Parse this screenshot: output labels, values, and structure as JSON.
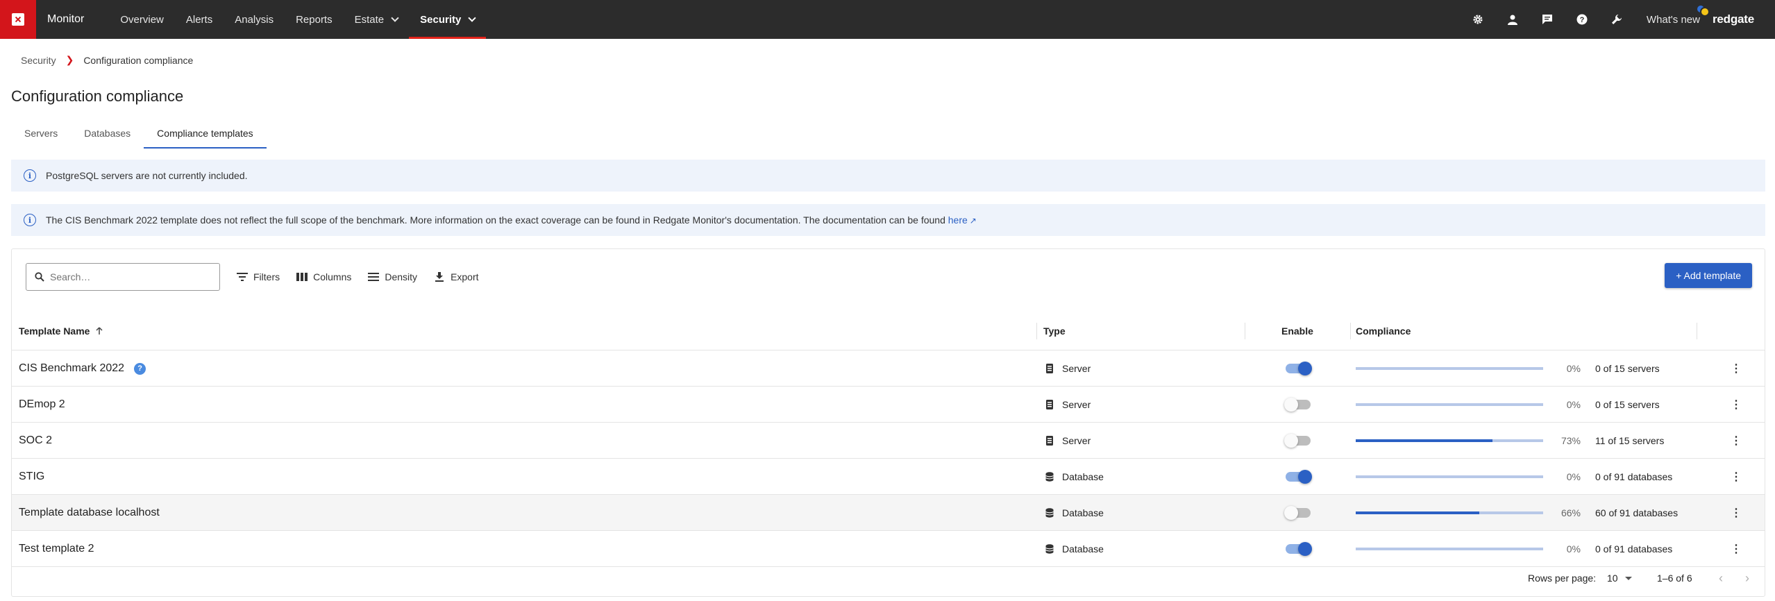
{
  "app": {
    "name": "Monitor",
    "brand": "redgate"
  },
  "nav": {
    "items": [
      {
        "label": "Overview"
      },
      {
        "label": "Alerts"
      },
      {
        "label": "Analysis"
      },
      {
        "label": "Reports"
      },
      {
        "label": "Estate"
      },
      {
        "label": "Security"
      }
    ],
    "active": "Security",
    "whats_new": "What's new",
    "icons": [
      "gear-icon",
      "user-icon",
      "chat-icon",
      "help-icon",
      "wrench-icon"
    ]
  },
  "breadcrumb": {
    "parent": "Security",
    "current": "Configuration compliance"
  },
  "page": {
    "title": "Configuration compliance"
  },
  "tabs": [
    {
      "label": "Servers"
    },
    {
      "label": "Databases"
    },
    {
      "label": "Compliance templates"
    }
  ],
  "alerts": {
    "postgres": "PostgreSQL servers are not currently included.",
    "cis_text": "The CIS Benchmark 2022 template does not reflect the full scope of the benchmark. More information on the exact coverage can be found in Redgate Monitor's documentation. The documentation can be found ",
    "cis_link": "here"
  },
  "toolbar": {
    "search_placeholder": "Search…",
    "filters": "Filters",
    "columns": "Columns",
    "density": "Density",
    "export": "Export",
    "add_template": "+ Add template"
  },
  "table": {
    "headers": {
      "name": "Template Name",
      "type": "Type",
      "enable": "Enable",
      "compliance": "Compliance"
    },
    "rows": [
      {
        "name": "CIS Benchmark 2022",
        "help": "?",
        "type": "Server",
        "enabled": true,
        "progress": 0,
        "pct": "0%",
        "summary": "0 of 15 servers"
      },
      {
        "name": "DEmop 2",
        "type": "Server",
        "enabled": false,
        "progress": 0,
        "pct": "0%",
        "summary": "0 of 15 servers"
      },
      {
        "name": "SOC 2",
        "type": "Server",
        "enabled": false,
        "progress": 73,
        "pct": "73%",
        "summary": "11 of 15 servers"
      },
      {
        "name": "STIG",
        "type": "Database",
        "enabled": true,
        "progress": 0,
        "pct": "0%",
        "summary": "0 of 91 databases"
      },
      {
        "name": "Template database localhost",
        "type": "Database",
        "enabled": false,
        "progress": 66,
        "pct": "66%",
        "summary": "60 of 91 databases"
      },
      {
        "name": "Test template 2",
        "type": "Database",
        "enabled": true,
        "progress": 0,
        "pct": "0%",
        "summary": "0 of 91 databases"
      }
    ]
  },
  "footer": {
    "rows_per_page_label": "Rows per page:",
    "rows_per_page": "10",
    "range": "1–6 of 6"
  },
  "colors": {
    "accent": "#2b60c4",
    "brand_red": "#d3151b",
    "topbar": "#2c2c2c",
    "alert_bg": "#eef3fb"
  }
}
